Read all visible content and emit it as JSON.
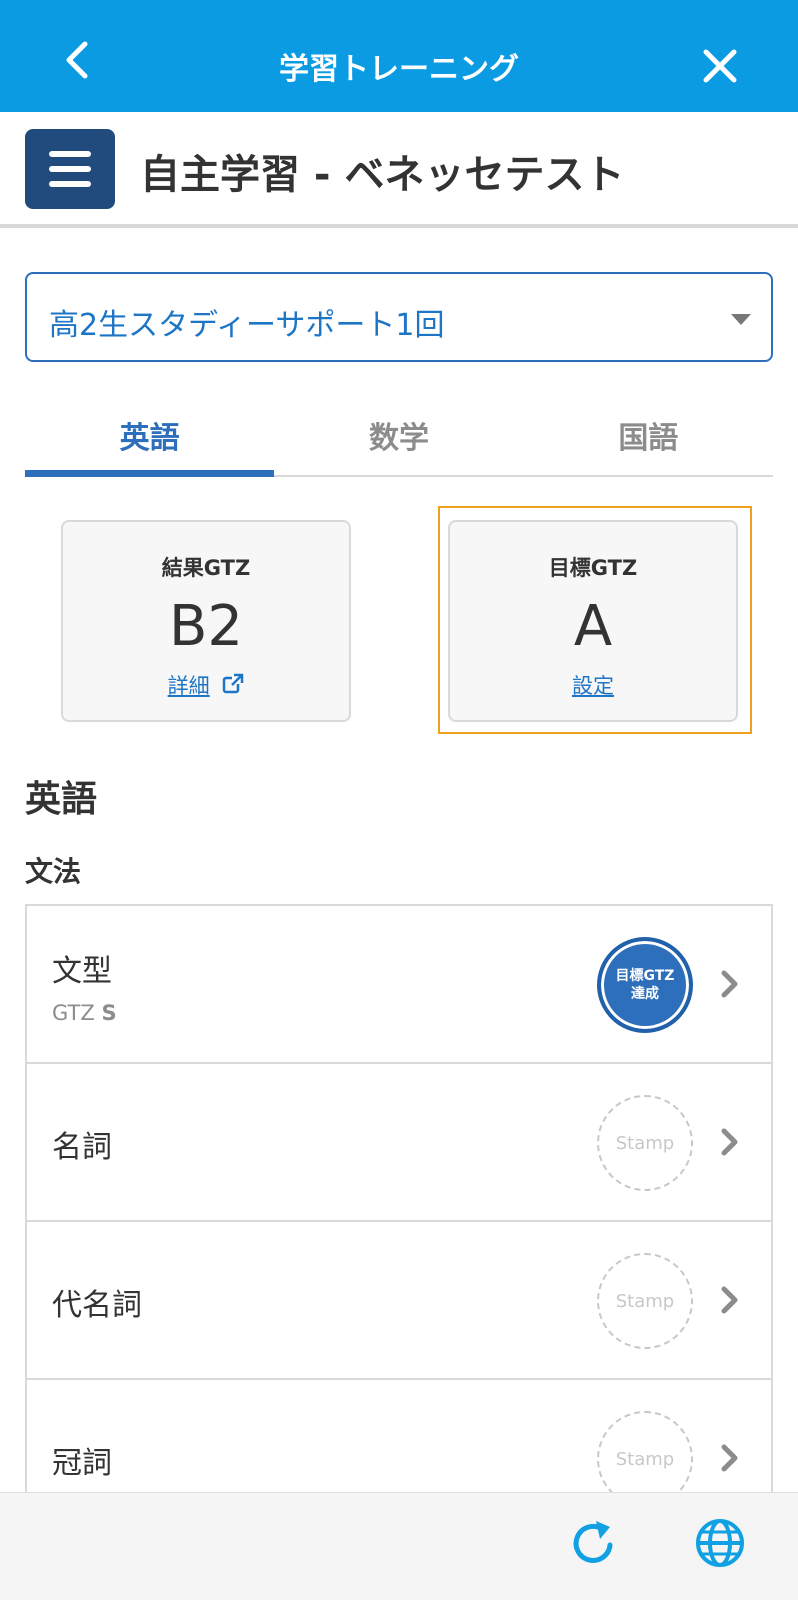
{
  "topbar": {
    "title": "学習トレーニング",
    "back_icon": "chevron-left-icon",
    "close_icon": "close-icon"
  },
  "header": {
    "title": "自主学習 - ベネッセテスト",
    "menu_icon": "hamburger-menu-icon"
  },
  "test_select": {
    "value": "高2生スタディーサポート1回"
  },
  "tabs": [
    {
      "label": "英語",
      "active": true
    },
    {
      "label": "数学",
      "active": false
    },
    {
      "label": "国語",
      "active": false
    }
  ],
  "result_card": {
    "label": "結果GTZ",
    "value": "B2",
    "link": "詳細"
  },
  "goal_card": {
    "label": "目標GTZ",
    "value": "A",
    "link": "設定"
  },
  "section": {
    "title": "英語",
    "subtitle": "文法"
  },
  "items": [
    {
      "name": "文型",
      "sub_prefix": "GTZ",
      "sub_value": "S",
      "stamp_line1": "目標GTZ",
      "stamp_line2": "達成"
    },
    {
      "name": "名詞",
      "stamp": "Stamp"
    },
    {
      "name": "代名詞",
      "stamp": "Stamp"
    },
    {
      "name": "冠詞",
      "stamp": "Stamp"
    }
  ],
  "colors": {
    "topbar": "#0a9be3",
    "accent": "#2d6fbb",
    "highlight": "#f0a020",
    "link": "#1d75c6"
  },
  "bottombar": {
    "reload_icon": "reload-icon",
    "globe_icon": "globe-icon"
  }
}
